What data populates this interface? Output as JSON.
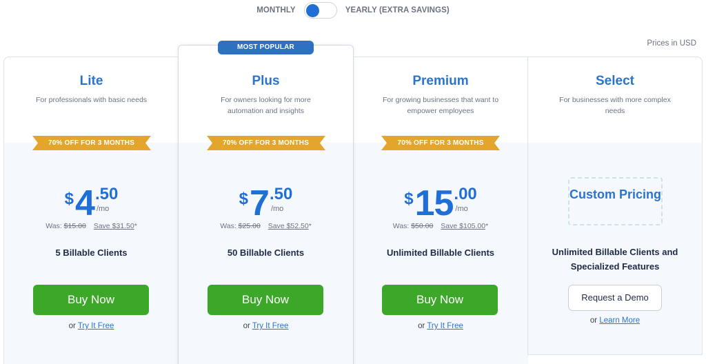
{
  "billing_toggle": {
    "monthly_label": "MONTHLY",
    "yearly_label": "YEARLY (EXTRA SAVINGS)",
    "selected": "monthly",
    "accent": "#1f6fd6"
  },
  "currency_note": "Prices in USD",
  "colors": {
    "title_blue": "#2a74cf",
    "price_blue": "#1f6fd6",
    "buy_green": "#3da72a",
    "ribbon_gold": "#e3a52b",
    "popular_badge": "#2d72c0"
  },
  "plans": [
    {
      "name": "Lite",
      "description": "For professionals with basic needs",
      "ribbon": "70% OFF FOR 3 MONTHS",
      "price": {
        "currency": "$",
        "whole": "4",
        "cents": ".50",
        "period": "/mo"
      },
      "was_label": "Was:",
      "was_price": "$15.00",
      "save": "Save $31.50",
      "save_suffix": "*",
      "clients": "5 Billable Clients",
      "cta": "Buy Now",
      "or_text": "or",
      "secondary_link": "Try It Free"
    },
    {
      "name": "Plus",
      "badge": "MOST POPULAR",
      "description": "For owners looking for more automation and insights",
      "ribbon": "70% OFF FOR 3 MONTHS",
      "price": {
        "currency": "$",
        "whole": "7",
        "cents": ".50",
        "period": "/mo"
      },
      "was_label": "Was:",
      "was_price": "$25.00",
      "save": "Save $52.50",
      "save_suffix": "*",
      "clients": "50 Billable Clients",
      "cta": "Buy Now",
      "or_text": "or",
      "secondary_link": "Try It Free"
    },
    {
      "name": "Premium",
      "description": "For growing businesses that want to empower employees",
      "ribbon": "70% OFF FOR 3 MONTHS",
      "price": {
        "currency": "$",
        "whole": "15",
        "cents": ".00",
        "period": "/mo"
      },
      "was_label": "Was:",
      "was_price": "$50.00",
      "save": "Save $105.00",
      "save_suffix": "*",
      "clients": "Unlimited Billable Clients",
      "cta": "Buy Now",
      "or_text": "or",
      "secondary_link": "Try It Free"
    },
    {
      "name": "Select",
      "description": "For businesses with more complex needs",
      "custom_pricing": "Custom Pricing",
      "clients": "Unlimited Billable Clients and Specialized Features",
      "cta": "Request a Demo",
      "or_text": "or",
      "secondary_link": "Learn More"
    }
  ]
}
